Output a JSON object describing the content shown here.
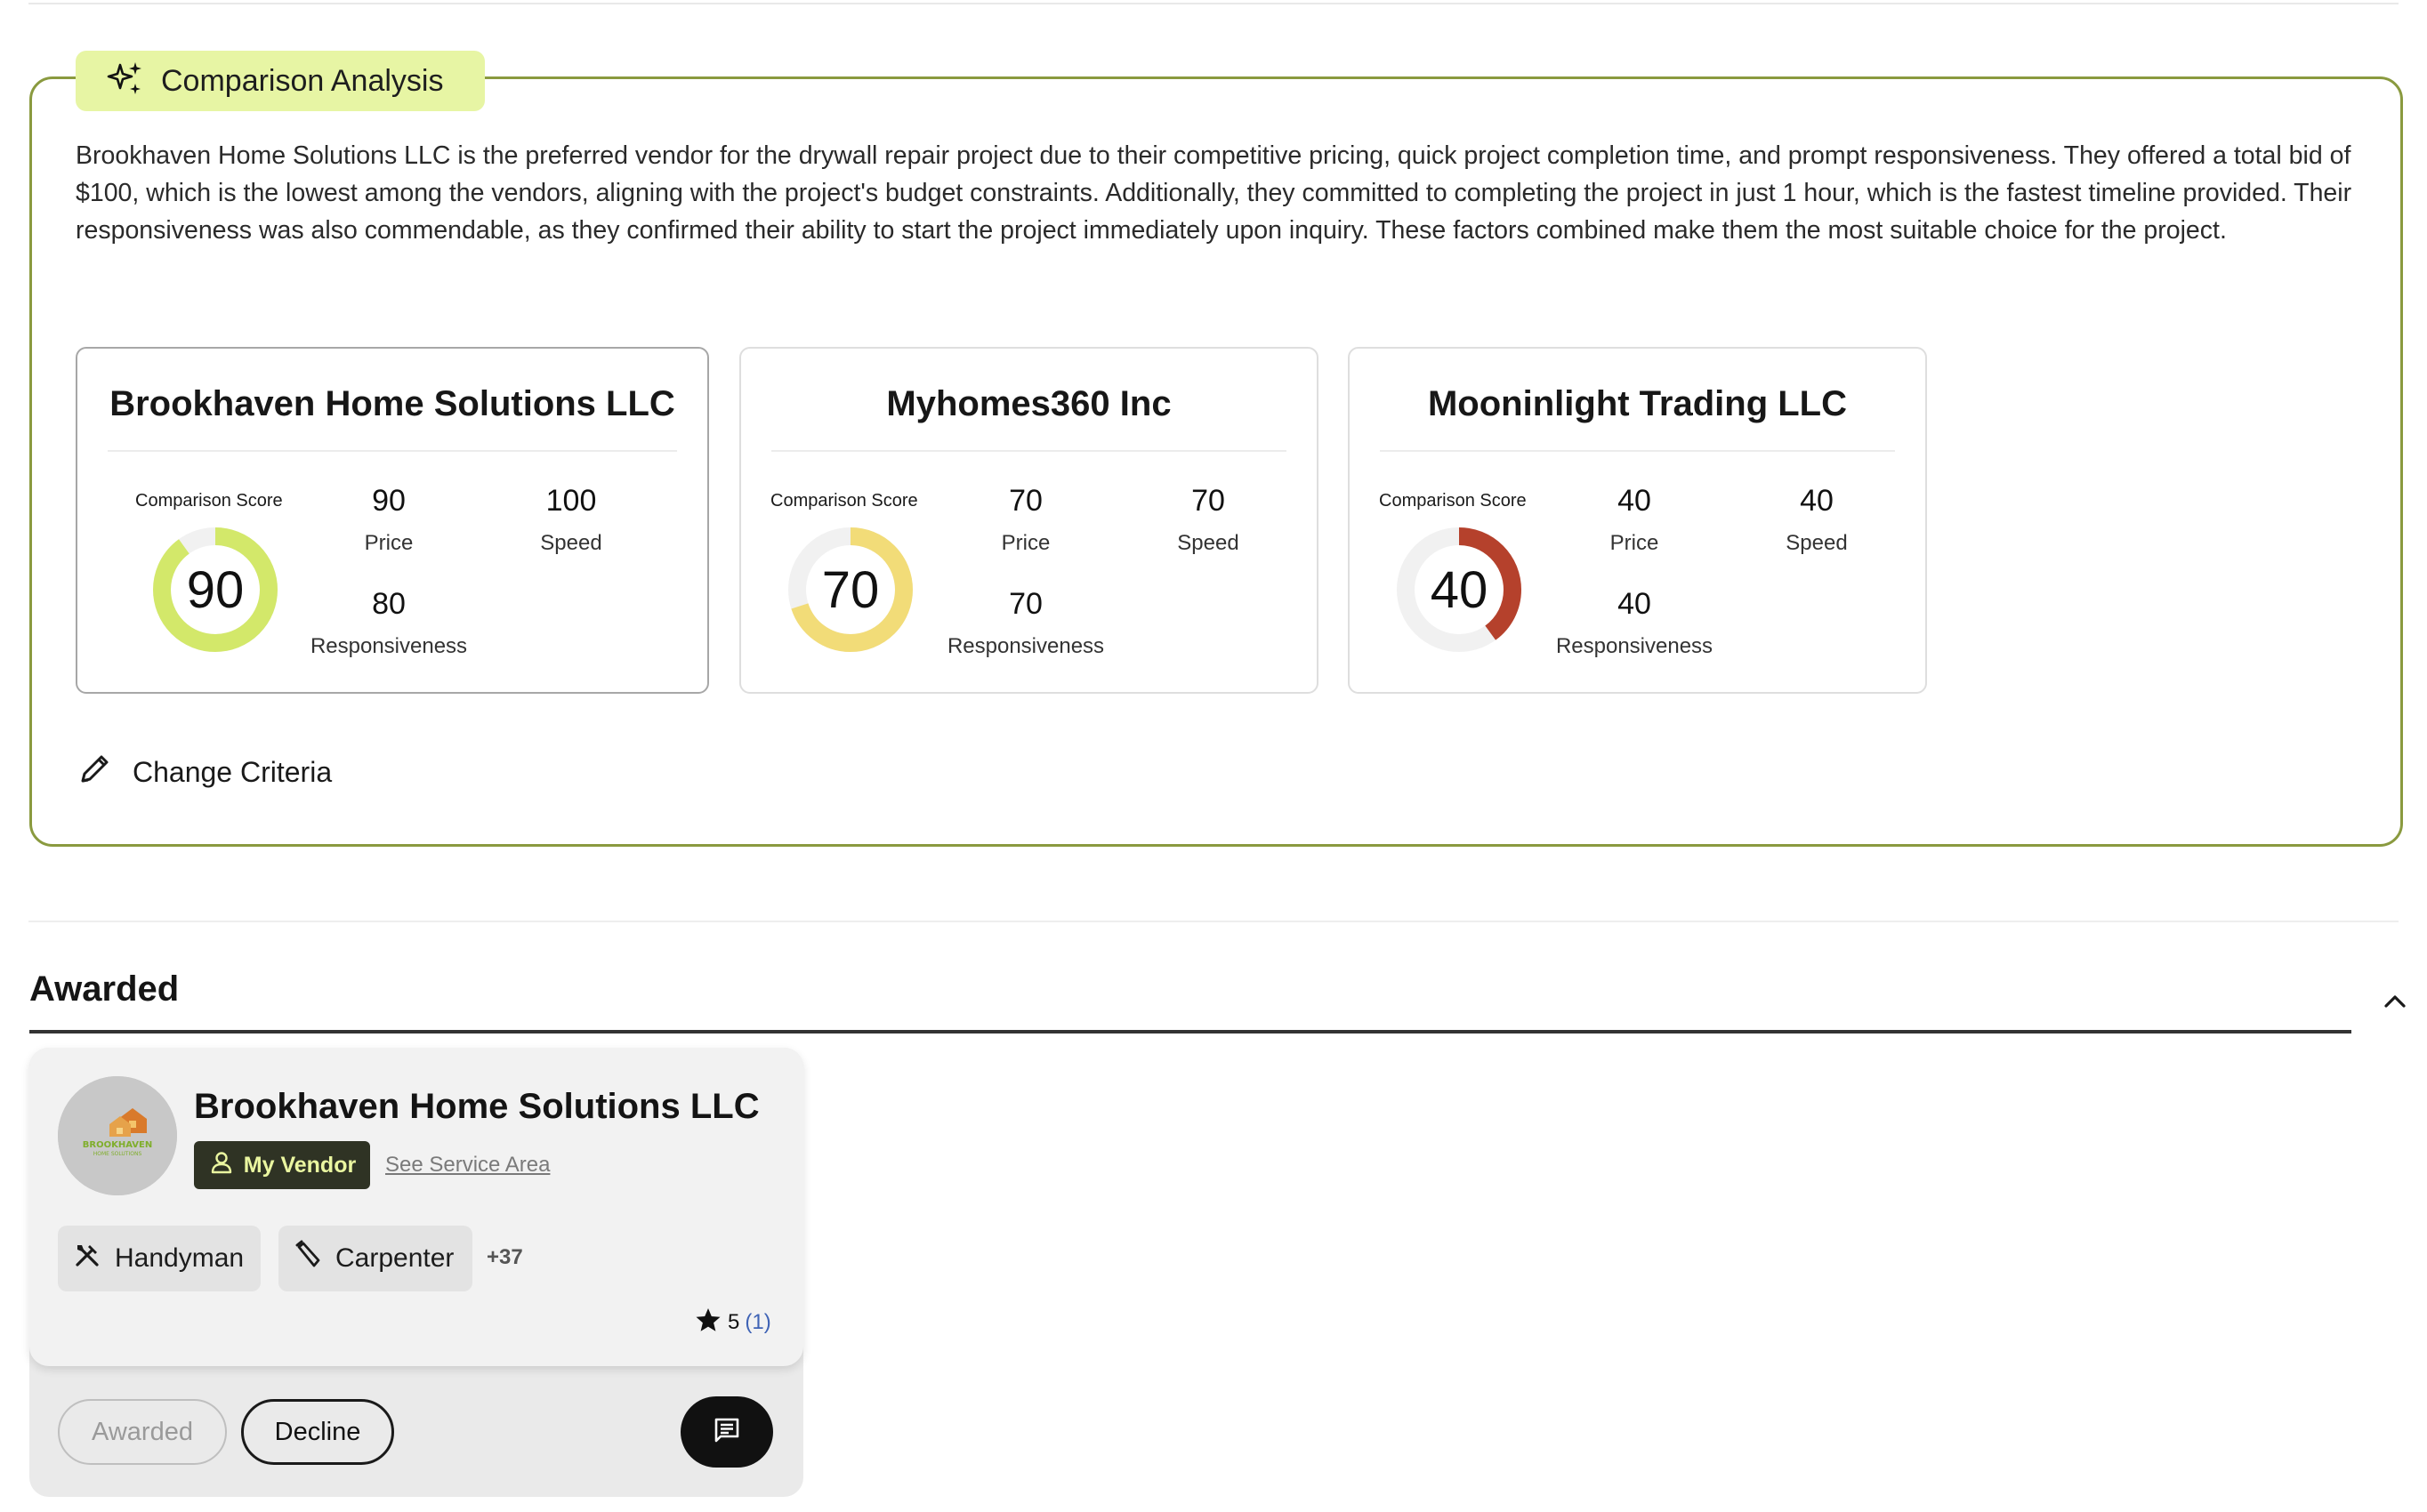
{
  "comparison": {
    "title": "Comparison Analysis",
    "icon": "sparkles-icon",
    "summary": "Brookhaven Home Solutions LLC is the preferred vendor for the drywall repair project due to their competitive pricing, quick project completion time, and prompt responsiveness. They offered a total bid of $100, which is the lowest among the vendors, aligning with the project's budget constraints. Additionally, they committed to completing the project in just 1 hour, which is the fastest timeline provided. Their responsiveness was also commendable, as they confirmed their ability to start the project immediately upon inquiry. These factors combined make them the most suitable choice for the project.",
    "score_label": "Comparison Score",
    "metric_labels": {
      "price": "Price",
      "speed": "Speed",
      "responsiveness": "Responsiveness"
    },
    "vendors": [
      {
        "name": "Brookhaven Home Solutions LLC",
        "score": 90,
        "price": 90,
        "speed": 100,
        "responsiveness": 80,
        "color": "#d3e86a",
        "selected": true
      },
      {
        "name": "Myhomes360 Inc",
        "score": 70,
        "price": 70,
        "speed": 70,
        "responsiveness": 70,
        "color": "#f2dc78",
        "selected": false
      },
      {
        "name": "Mooninlight Trading LLC",
        "score": 40,
        "price": 40,
        "speed": 40,
        "responsiveness": 40,
        "color": "#b5412c",
        "selected": false
      }
    ],
    "change_criteria_label": "Change Criteria",
    "change_criteria_icon": "pencil-icon"
  },
  "awarded": {
    "section_title": "Awarded",
    "collapse_icon": "chevron-up-icon",
    "vendor": {
      "name": "Brookhaven Home Solutions LLC",
      "badge_label": "My Vendor",
      "service_area_link": "See Service Area",
      "logo_text": "BROOKHAVEN",
      "logo_subtext": "HOME SOLUTIONS",
      "categories": [
        {
          "label": "Handyman",
          "icon": "tools-icon"
        },
        {
          "label": "Carpenter",
          "icon": "saw-icon"
        }
      ],
      "more_categories": "+37",
      "rating": "5",
      "review_count": "(1)"
    },
    "actions": {
      "awarded_label": "Awarded",
      "decline_label": "Decline",
      "message_icon": "message-icon"
    }
  }
}
